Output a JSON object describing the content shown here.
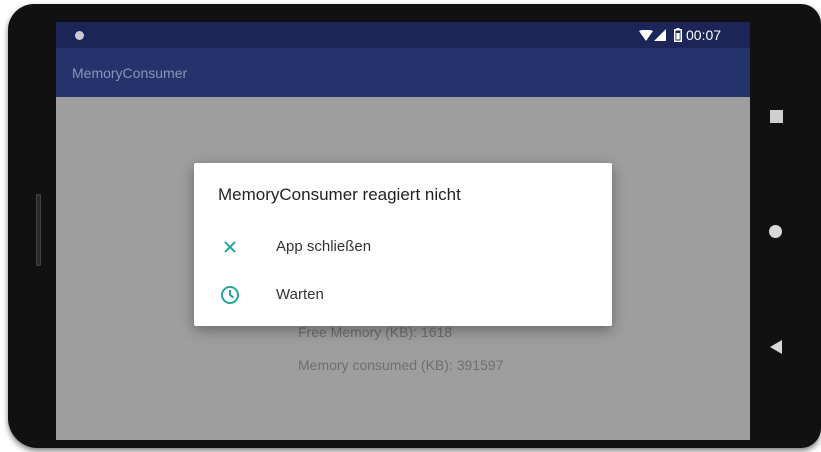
{
  "status_bar": {
    "time": "00:07",
    "icons": [
      "notification-dot-icon",
      "wifi-icon",
      "signal-icon",
      "battery-icon"
    ]
  },
  "app_bar": {
    "title": "MemoryConsumer"
  },
  "content": {
    "free_memory": "Free Memory (KB): 1618",
    "memory_consumed": "Memory consumed (KB): 391597"
  },
  "dialog": {
    "title": "MemoryConsumer reagiert nicht",
    "options": [
      {
        "label": "App schließen",
        "icon": "close-icon"
      },
      {
        "label": "Warten",
        "icon": "clock-icon"
      }
    ]
  },
  "navigation": {
    "buttons": [
      "recents-icon",
      "home-icon",
      "back-icon"
    ]
  },
  "colors": {
    "status_bar": "#1b2557",
    "app_bar": "#25336d",
    "accent": "#26a69a",
    "scrim_background": "#9e9e9e"
  }
}
